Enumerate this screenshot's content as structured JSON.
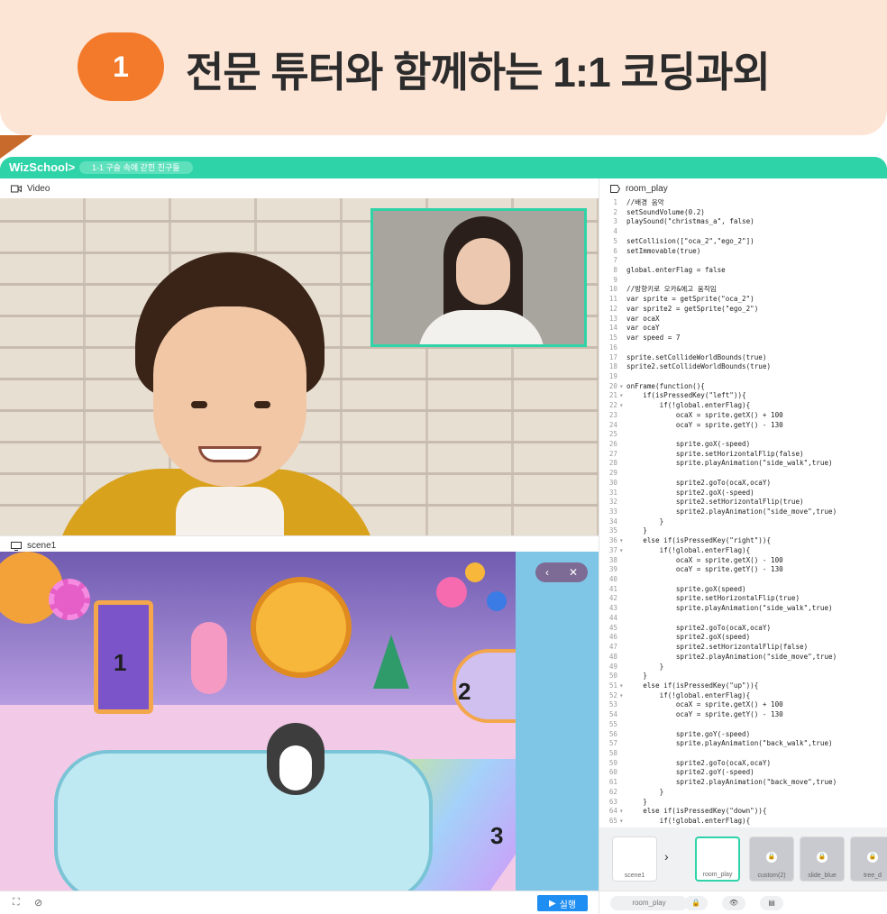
{
  "banner": {
    "badge": "1",
    "title": "전문 튜터와 함께하는 1:1 코딩과외"
  },
  "topbar": {
    "logo": "WizSchool>",
    "class_name": "1-1 구슬 속에 갇힌 친구들"
  },
  "video_panel": {
    "label": "Video",
    "icon": "video-camera-icon"
  },
  "scene_panel": {
    "label": "scene1",
    "icon": "monitor-icon",
    "numbers": [
      "1",
      "2",
      "3"
    ]
  },
  "code_panel": {
    "label": "room_play",
    "lines": [
      {
        "n": "1",
        "f": "",
        "t": "//배경 음악"
      },
      {
        "n": "2",
        "f": "",
        "t": "setSoundVolume(0.2)"
      },
      {
        "n": "3",
        "f": "",
        "t": "playSound(\"christmas_a\", false)"
      },
      {
        "n": "4",
        "f": "",
        "t": ""
      },
      {
        "n": "5",
        "f": "",
        "t": "setCollision([\"oca_2\",\"ego_2\"])"
      },
      {
        "n": "6",
        "f": "",
        "t": "setImmovable(true)"
      },
      {
        "n": "7",
        "f": "",
        "t": ""
      },
      {
        "n": "8",
        "f": "",
        "t": "global.enterFlag = false"
      },
      {
        "n": "9",
        "f": "",
        "t": ""
      },
      {
        "n": "10",
        "f": "",
        "t": "//방향키로 오카&에고 움직임"
      },
      {
        "n": "11",
        "f": "",
        "t": "var sprite = getSprite(\"oca_2\")"
      },
      {
        "n": "12",
        "f": "",
        "t": "var sprite2 = getSprite(\"ego_2\")"
      },
      {
        "n": "13",
        "f": "",
        "t": "var ocaX"
      },
      {
        "n": "14",
        "f": "",
        "t": "var ocaY"
      },
      {
        "n": "15",
        "f": "",
        "t": "var speed = 7"
      },
      {
        "n": "16",
        "f": "",
        "t": ""
      },
      {
        "n": "17",
        "f": "",
        "t": "sprite.setCollideWorldBounds(true)"
      },
      {
        "n": "18",
        "f": "",
        "t": "sprite2.setCollideWorldBounds(true)"
      },
      {
        "n": "19",
        "f": "",
        "t": ""
      },
      {
        "n": "20",
        "f": "▾",
        "t": "onFrame(function(){"
      },
      {
        "n": "21",
        "f": "▾",
        "t": "    if(isPressedKey(\"left\")){"
      },
      {
        "n": "22",
        "f": "▾",
        "t": "        if(!global.enterFlag){"
      },
      {
        "n": "23",
        "f": "",
        "t": "            ocaX = sprite.getX() + 100"
      },
      {
        "n": "24",
        "f": "",
        "t": "            ocaY = sprite.getY() - 130"
      },
      {
        "n": "25",
        "f": "",
        "t": ""
      },
      {
        "n": "26",
        "f": "",
        "t": "            sprite.goX(-speed)"
      },
      {
        "n": "27",
        "f": "",
        "t": "            sprite.setHorizontalFlip(false)"
      },
      {
        "n": "28",
        "f": "",
        "t": "            sprite.playAnimation(\"side_walk\",true)"
      },
      {
        "n": "29",
        "f": "",
        "t": ""
      },
      {
        "n": "30",
        "f": "",
        "t": "            sprite2.goTo(ocaX,ocaY)"
      },
      {
        "n": "31",
        "f": "",
        "t": "            sprite2.goX(-speed)"
      },
      {
        "n": "32",
        "f": "",
        "t": "            sprite2.setHorizontalFlip(true)"
      },
      {
        "n": "33",
        "f": "",
        "t": "            sprite2.playAnimation(\"side_move\",true)"
      },
      {
        "n": "34",
        "f": "",
        "t": "        }"
      },
      {
        "n": "35",
        "f": "",
        "t": "    }"
      },
      {
        "n": "36",
        "f": "▾",
        "t": "    else if(isPressedKey(\"right\")){"
      },
      {
        "n": "37",
        "f": "▾",
        "t": "        if(!global.enterFlag){"
      },
      {
        "n": "38",
        "f": "",
        "t": "            ocaX = sprite.getX() - 100"
      },
      {
        "n": "39",
        "f": "",
        "t": "            ocaY = sprite.getY() - 130"
      },
      {
        "n": "40",
        "f": "",
        "t": ""
      },
      {
        "n": "41",
        "f": "",
        "t": "            sprite.goX(speed)"
      },
      {
        "n": "42",
        "f": "",
        "t": "            sprite.setHorizontalFlip(true)"
      },
      {
        "n": "43",
        "f": "",
        "t": "            sprite.playAnimation(\"side_walk\",true)"
      },
      {
        "n": "44",
        "f": "",
        "t": ""
      },
      {
        "n": "45",
        "f": "",
        "t": "            sprite2.goTo(ocaX,ocaY)"
      },
      {
        "n": "46",
        "f": "",
        "t": "            sprite2.goX(speed)"
      },
      {
        "n": "47",
        "f": "",
        "t": "            sprite2.setHorizontalFlip(false)"
      },
      {
        "n": "48",
        "f": "",
        "t": "            sprite2.playAnimation(\"side_move\",true)"
      },
      {
        "n": "49",
        "f": "",
        "t": "        }"
      },
      {
        "n": "50",
        "f": "",
        "t": "    }"
      },
      {
        "n": "51",
        "f": "▾",
        "t": "    else if(isPressedKey(\"up\")){"
      },
      {
        "n": "52",
        "f": "▾",
        "t": "        if(!global.enterFlag){"
      },
      {
        "n": "53",
        "f": "",
        "t": "            ocaX = sprite.getX() + 100"
      },
      {
        "n": "54",
        "f": "",
        "t": "            ocaY = sprite.getY() - 130"
      },
      {
        "n": "55",
        "f": "",
        "t": ""
      },
      {
        "n": "56",
        "f": "",
        "t": "            sprite.goY(-speed)"
      },
      {
        "n": "57",
        "f": "",
        "t": "            sprite.playAnimation(\"back_walk\",true)"
      },
      {
        "n": "58",
        "f": "",
        "t": ""
      },
      {
        "n": "59",
        "f": "",
        "t": "            sprite2.goTo(ocaX,ocaY)"
      },
      {
        "n": "60",
        "f": "",
        "t": "            sprite2.goY(-speed)"
      },
      {
        "n": "61",
        "f": "",
        "t": "            sprite2.playAnimation(\"back_move\",true)"
      },
      {
        "n": "62",
        "f": "",
        "t": "        }"
      },
      {
        "n": "63",
        "f": "",
        "t": "    }"
      },
      {
        "n": "64",
        "f": "▾",
        "t": "    else if(isPressedKey(\"down\")){"
      },
      {
        "n": "65",
        "f": "▾",
        "t": "        if(!global.enterFlag){"
      }
    ]
  },
  "scenes": [
    {
      "label": "scene1",
      "locked": false,
      "active": false
    },
    {
      "label": "room_play",
      "locked": false,
      "active": true
    },
    {
      "label": "custom(2)",
      "locked": true,
      "active": false
    },
    {
      "label": "slide_blue",
      "locked": true,
      "active": false
    },
    {
      "label": "tree_d",
      "locked": true,
      "active": false
    }
  ],
  "run_button": {
    "label": "실행"
  },
  "footer": {
    "scene_name": "room_play"
  },
  "colors": {
    "accent": "#2ed3a8",
    "badge": "#f37a2b",
    "banner_bg": "#fde5d6",
    "run": "#1f8ef2"
  }
}
